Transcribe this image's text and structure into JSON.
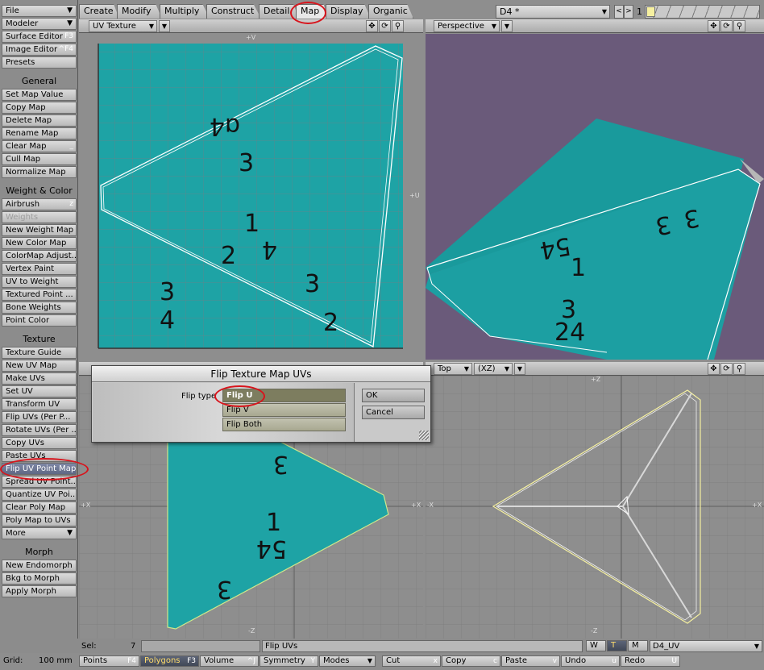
{
  "sidebar": {
    "items": [
      {
        "label": "File",
        "arrow": "▼"
      },
      {
        "label": "Modeler",
        "arrow": "▼"
      },
      {
        "label": "Surface Editor",
        "key": "F3"
      },
      {
        "label": "Image Editor",
        "key": "^F4"
      },
      {
        "label": "Presets"
      },
      {
        "heading": "General"
      },
      {
        "label": "Set Map Value"
      },
      {
        "label": "Copy Map"
      },
      {
        "label": "Delete Map"
      },
      {
        "label": "Rename Map"
      },
      {
        "label": "Clear Map",
        "key": "_"
      },
      {
        "label": "Cull Map"
      },
      {
        "label": "Normalize Map"
      },
      {
        "heading": "Weight & Color"
      },
      {
        "label": "Airbrush",
        "key": "z"
      },
      {
        "label": "Weights",
        "disabled": true
      },
      {
        "label": "New Weight Map"
      },
      {
        "label": "New Color Map"
      },
      {
        "label": "ColorMap Adjust..."
      },
      {
        "label": "Vertex Paint"
      },
      {
        "label": "UV to Weight"
      },
      {
        "label": "Textured Point ..."
      },
      {
        "label": "Bone Weights"
      },
      {
        "label": "Point Color"
      },
      {
        "heading": "Texture"
      },
      {
        "label": "Texture Guide"
      },
      {
        "label": "New UV Map"
      },
      {
        "label": "Make UVs"
      },
      {
        "label": "Set UV"
      },
      {
        "label": "Transform UV"
      },
      {
        "label": "Flip UVs (Per P..."
      },
      {
        "label": "Rotate UVs (Per ..."
      },
      {
        "label": "Copy UVs"
      },
      {
        "label": "Paste UVs"
      },
      {
        "label": "Flip UV Point Map",
        "active": true
      },
      {
        "label": "Spread UV Point..."
      },
      {
        "label": "Quantize UV Poi..."
      },
      {
        "label": "Clear Poly Map"
      },
      {
        "label": "Poly Map to UVs"
      },
      {
        "label": "More",
        "arrow": "▼"
      },
      {
        "heading": "Morph"
      },
      {
        "label": "New Endomorph"
      },
      {
        "label": "Bkg to Morph"
      },
      {
        "label": "Apply Morph"
      }
    ]
  },
  "tabs": [
    {
      "label": "Create"
    },
    {
      "label": "Modify"
    },
    {
      "label": "Multiply"
    },
    {
      "label": "Construct"
    },
    {
      "label": "Detail"
    },
    {
      "label": "Map",
      "selected": true
    },
    {
      "label": "Display"
    },
    {
      "label": "Organic"
    }
  ],
  "layer": {
    "object": "D4 *",
    "layer_num": "1"
  },
  "viewports": {
    "top_left": {
      "mode": "UV Texture",
      "axis_top": "+V",
      "axis_right": "+U"
    },
    "top_right": {
      "mode": "Perspective"
    },
    "bottom_left": {
      "axis_left": "+X",
      "axis_right": "+X",
      "axis_bottom": "-Z"
    },
    "bottom_right": {
      "mode": "Top",
      "plane": "(XZ)",
      "axis_top": "+Z",
      "axis_bottom": "-Z",
      "axis_left": "-X",
      "axis_right": "+X"
    }
  },
  "dialog": {
    "title": "Flip Texture Map UVs",
    "label": "Flip type",
    "options": [
      {
        "label": "Flip U",
        "selected": true
      },
      {
        "label": "Flip V"
      },
      {
        "label": "Flip Both"
      }
    ],
    "ok": "OK",
    "cancel": "Cancel"
  },
  "status": {
    "grid_label": "Grid:",
    "grid_value": "100 mm",
    "sel_label": "Sel:",
    "sel_value": "7",
    "message": "Flip UVs",
    "wtm": [
      "W",
      "T",
      "M"
    ],
    "wtm_active": "T",
    "map_name": "D4_UV"
  },
  "bottom_bar": [
    {
      "label": "Points",
      "key": "F4"
    },
    {
      "label": "Polygons",
      "key": "F3",
      "active": true
    },
    {
      "label": "Volume",
      "key": "^J"
    },
    {
      "label": "Symmetry",
      "key": "Y"
    },
    {
      "label": "Modes",
      "arrow": "▼"
    },
    {
      "label": "Cut",
      "key": "x"
    },
    {
      "label": "Copy",
      "key": "c"
    },
    {
      "label": "Paste",
      "key": "v"
    },
    {
      "label": "Undo",
      "key": "u"
    },
    {
      "label": "Redo",
      "key": "U"
    }
  ],
  "icons": {
    "move": "move-icon",
    "rotate": "rotate-icon",
    "zoom": "zoom-icon"
  },
  "colors": {
    "teal": "#1ea3a5",
    "perspective_bg": "#6a5a7a",
    "accent_red": "#d8141c",
    "selected_blue": "#5f6884"
  }
}
